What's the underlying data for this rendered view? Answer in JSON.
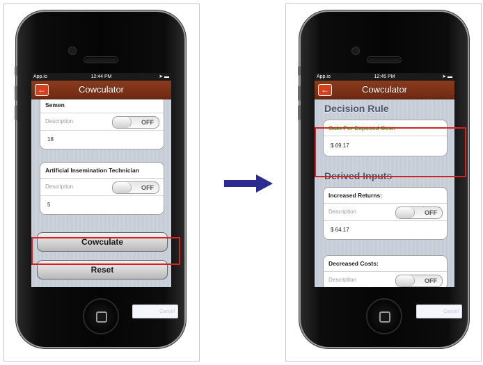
{
  "colors": {
    "nav_bar": "#7a3219",
    "back_button": "#d6401c",
    "highlight": "#d32222",
    "arrow": "#2c2b8f",
    "green_label": "#29c41f"
  },
  "left": {
    "status": {
      "carrier": "App.io",
      "time": "12:44 PM"
    },
    "nav": {
      "title": "Cowculator"
    },
    "semen": {
      "label": "Semen",
      "description": "Description",
      "toggle": "OFF",
      "value": "18"
    },
    "ait": {
      "label": "Artificial Insemination Technician",
      "description": "Description",
      "toggle": "OFF",
      "value": "5"
    },
    "cowculate_label": "Cowculate",
    "reset_label": "Reset",
    "ad_text": "Cancel"
  },
  "right": {
    "status": {
      "carrier": "App.io",
      "time": "12:45 PM"
    },
    "nav": {
      "title": "Cowculator"
    },
    "decision_rule": "Decision Rule",
    "gain": {
      "label": "Gain Per Exposed Cow:",
      "value": "$ 69.17"
    },
    "derived_inputs": "Derived Inputs",
    "increased": {
      "label": "Increased Returns:",
      "description": "Description",
      "toggle": "OFF",
      "value": "$ 64.17"
    },
    "decreased": {
      "label": "Decreased Costs:",
      "description": "Description",
      "toggle": "OFF"
    },
    "ad_text": "Cancel"
  }
}
